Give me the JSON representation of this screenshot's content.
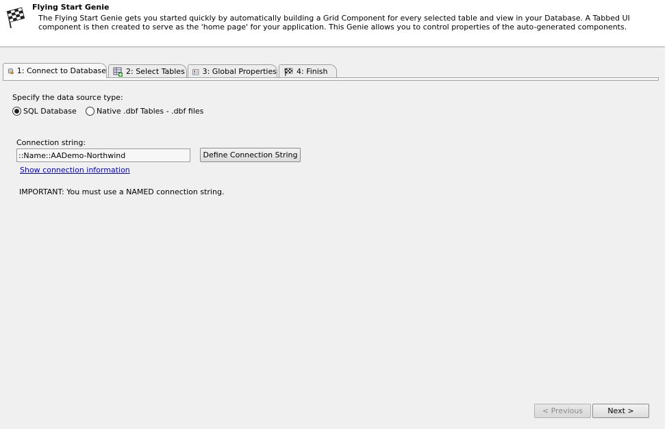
{
  "header": {
    "title": "Flying Start Genie",
    "description": "The Flying Start Genie gets you started quickly by automatically building a Grid Component for every selected table and view in your Database. A Tabbed UI component is then created to serve as the 'home page' for your application. This Genie allows you to control properties of the auto-generated components."
  },
  "tabs": [
    {
      "label": "1: Connect to Database",
      "icon": "database-icon",
      "active": true
    },
    {
      "label": "2: Select Tables",
      "icon": "table-add-icon"
    },
    {
      "label": "3: Global Properties",
      "icon": "properties-icon"
    },
    {
      "label": "4: Finish",
      "icon": "checkered-flag-icon"
    }
  ],
  "datasource": {
    "prompt": "Specify the data source type:",
    "options": [
      "SQL Database",
      "Native .dbf Tables - .dbf files"
    ],
    "selected": "SQL Database"
  },
  "connection": {
    "label": "Connection string:",
    "value": "::Name::AADemo-Northwind",
    "define_button": "Define Connection String",
    "show_info_link": "Show connection information",
    "important": "IMPORTANT: You must use a NAMED connection string."
  },
  "nav": {
    "previous": "< Previous",
    "next": "Next >"
  }
}
